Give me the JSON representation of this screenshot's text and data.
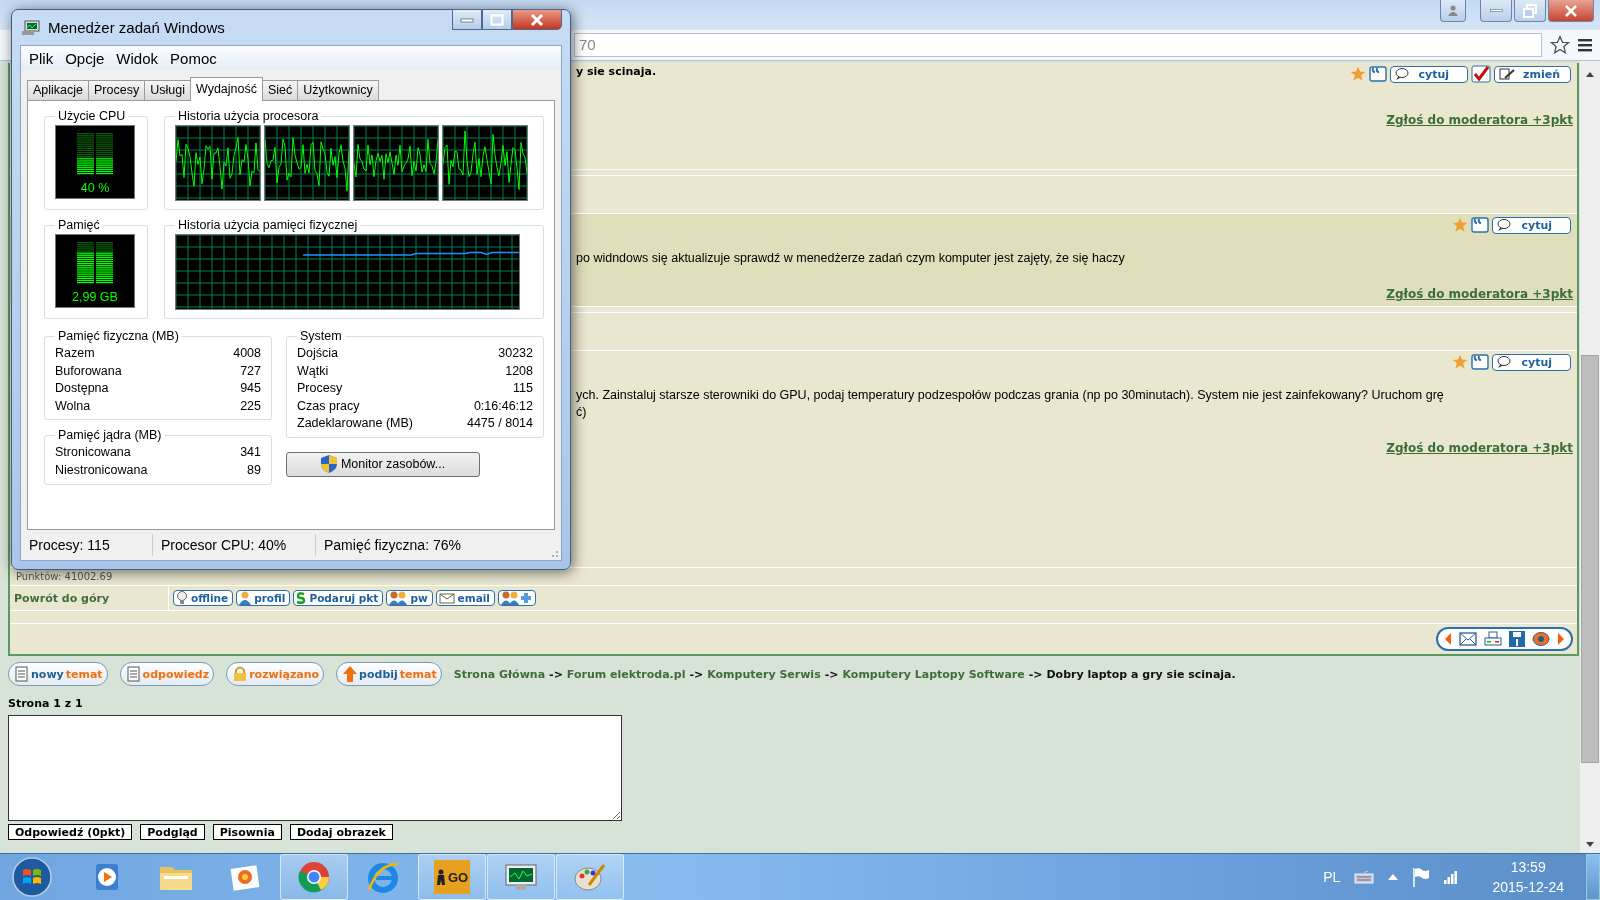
{
  "browser": {
    "address_fragment": "70"
  },
  "task_manager": {
    "title": "Menedżer zadań Windows",
    "menu": [
      "Plik",
      "Opcje",
      "Widok",
      "Pomoc"
    ],
    "tabs": [
      {
        "label": "Aplikacje",
        "selected": false
      },
      {
        "label": "Procesy",
        "selected": false
      },
      {
        "label": "Usługi",
        "selected": false
      },
      {
        "label": "Wydajność",
        "selected": true
      },
      {
        "label": "Sieć",
        "selected": false
      },
      {
        "label": "Użytkownicy",
        "selected": false
      }
    ],
    "cpu_usage": {
      "title": "Użycie CPU",
      "reading": "40 %",
      "level": 0.4
    },
    "cpu_history": {
      "title": "Historia użycia procesora"
    },
    "memory": {
      "title": "Pamięć",
      "reading": "2,99 GB",
      "level": 0.75
    },
    "memory_history": {
      "title": "Historia użycia pamięci fizycznej"
    },
    "physical_memory": {
      "title": "Pamięć fizyczna (MB)",
      "rows": [
        {
          "label": "Razem",
          "value": "4008"
        },
        {
          "label": "Buforowana",
          "value": "727"
        },
        {
          "label": "Dostępna",
          "value": "945"
        },
        {
          "label": "Wolna",
          "value": "225"
        }
      ]
    },
    "kernel_memory": {
      "title": "Pamięć jądra (MB)",
      "rows": [
        {
          "label": "Stronicowana",
          "value": "341"
        },
        {
          "label": "Niestronicowana",
          "value": "89"
        }
      ]
    },
    "system": {
      "title": "System",
      "rows": [
        {
          "label": "Dojścia",
          "value": "30232"
        },
        {
          "label": "Wątki",
          "value": "1208"
        },
        {
          "label": "Procesy",
          "value": "115"
        },
        {
          "label": "Czas pracy",
          "value": "0:16:46:12"
        },
        {
          "label": "Zadeklarowane (MB)",
          "value": "4475 / 8014"
        }
      ]
    },
    "resource_monitor_button": "Monitor zasobów...",
    "status_bar": [
      "Procesy: 115",
      "Procesor CPU: 40%",
      "Pamięć fizyczna: 76%"
    ]
  },
  "forum": {
    "posts": [
      {
        "title": "y sie scinaja.",
        "actions": [
          {
            "kind": "quote",
            "label": "cytuj"
          },
          {
            "kind": "accept"
          },
          {
            "kind": "edit",
            "label": "zmień"
          }
        ],
        "report": "Zgłoś do moderatora +3pkt"
      },
      {
        "lines": [
          "po widndows się aktualizuje sprawdź w menedżerze zadań czym komputer jest zajęty, że się haczy"
        ],
        "actions": [
          {
            "kind": "quote",
            "label": "cytuj"
          }
        ],
        "report": "Zgłoś do moderatora +3pkt"
      },
      {
        "lines": [
          "ych. Zainstaluj starsze sterowniki do GPU, podaj temperatury podzespołów podczas grania (np po 30minutach). System nie jest zainfekowany? Uruchom grę",
          "ć)"
        ],
        "actions": [
          {
            "kind": "quote",
            "label": "cytuj"
          }
        ],
        "report": "Zgłoś do moderatora +3pkt"
      }
    ],
    "points": "Punktów: 41002.69",
    "back_to_top": "Powrót do góry",
    "profile_buttons": [
      {
        "kind": "offline",
        "label": "offline"
      },
      {
        "kind": "profile",
        "label": "profil"
      },
      {
        "kind": "gift",
        "label": "Podaruj pkt"
      },
      {
        "kind": "pm",
        "label": "pw"
      },
      {
        "kind": "email",
        "label": "email"
      },
      {
        "kind": "add_friend"
      }
    ],
    "topic_buttons": [
      {
        "kind": "new",
        "prefix": "nowy",
        "label": "temat"
      },
      {
        "kind": "reply",
        "label": "odpowiedz"
      },
      {
        "kind": "solved",
        "label": "rozwiązano"
      },
      {
        "kind": "bump",
        "prefix": "podbij",
        "label": "temat"
      }
    ],
    "breadcrumb": [
      {
        "kind": "link",
        "text": "Strona Główna"
      },
      {
        "kind": "arrow",
        "text": "->"
      },
      {
        "kind": "link",
        "text": "Forum elektroda.pl"
      },
      {
        "kind": "arrow",
        "text": "->"
      },
      {
        "kind": "link",
        "text": "Komputery Serwis"
      },
      {
        "kind": "arrow",
        "text": "->"
      },
      {
        "kind": "link",
        "text": "Komputery Laptopy Software"
      },
      {
        "kind": "arrow",
        "text": "->"
      },
      {
        "kind": "current",
        "text": "Dobry laptop a gry sie scinaja."
      }
    ],
    "pages": "Strona 1 z 1",
    "reply_buttons": [
      "Odpowiedź (0pkt)",
      "Podgląd",
      "Pisownia",
      "Dodaj obrazek"
    ]
  },
  "taskbar": {
    "apps": [
      {
        "kind": "media",
        "running": false
      },
      {
        "kind": "folder",
        "running": false
      },
      {
        "kind": "photos",
        "running": false
      },
      {
        "kind": "chrome",
        "running": true
      },
      {
        "kind": "ie",
        "running": false
      },
      {
        "kind": "game",
        "running": true,
        "label": "GO"
      },
      {
        "kind": "monitor",
        "running": true
      },
      {
        "kind": "paint",
        "running": true
      }
    ],
    "language": "PL",
    "time": "13:59",
    "date": "2015-12-24"
  }
}
